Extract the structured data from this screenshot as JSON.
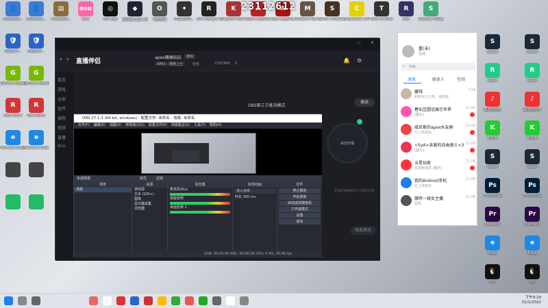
{
  "overlay": {
    "text": "23112612"
  },
  "desktop_left": [
    {
      "label": "Administr...",
      "color": "#3a7bd5",
      "glyph": "👤"
    },
    {
      "label": "DigiSoft...",
      "color": "#2a64c7",
      "glyph": "🛡"
    },
    {
      "label": "GeForce Experience",
      "color": "#76b900",
      "glyph": "G"
    },
    {
      "label": "Riot Client",
      "color": "#d13639",
      "glyph": "R"
    },
    {
      "label": "Microsoft Edge",
      "color": "#1e88e5",
      "glyph": "e"
    },
    {
      "label": "",
      "color": "#444",
      "glyph": ""
    },
    {
      "label": "",
      "color": "#2b6",
      "glyph": ""
    }
  ],
  "desktop_top": [
    {
      "label": "ItTakesTw...",
      "color": "#8a6c3c",
      "glyph": "▤"
    },
    {
      "label": "osu!",
      "color": "#ff66aa",
      "glyph": "osu"
    },
    {
      "label": "Aim Lab",
      "color": "#111",
      "glyph": "◎"
    },
    {
      "label": "战网ApexD2 2042",
      "color": "#223",
      "glyph": "◆"
    },
    {
      "label": "守望先锋",
      "color": "#555",
      "glyph": "O"
    },
    {
      "label": "HELLDIVE...",
      "color": "#333",
      "glyph": "✦"
    },
    {
      "label": "Tom Clancy's Rainbow...",
      "color": "#222",
      "glyph": "R"
    },
    {
      "label": "Kingdom Rush Vengeance",
      "color": "#a33",
      "glyph": "K"
    },
    {
      "label": "Apex Legends",
      "color": "#b22",
      "glyph": "A"
    },
    {
      "label": "Apex Legends",
      "color": "#a11",
      "glyph": "A"
    },
    {
      "label": "Medieval Dynasty",
      "color": "#654",
      "glyph": "M"
    },
    {
      "label": "Sekiro Shadows",
      "color": "#432",
      "glyph": "S"
    },
    {
      "label": "Cyberpunk 2077",
      "color": "#e5d100",
      "glyph": "C"
    },
    {
      "label": "Tales of Arise",
      "color": "#333",
      "glyph": "T"
    },
    {
      "label": "Raft",
      "color": "#336",
      "glyph": "R"
    },
    {
      "label": "Stardew Valley",
      "color": "#4a7",
      "glyph": "S"
    }
  ],
  "desktop_right": [
    {
      "label": "Steam",
      "color": "#1b2838",
      "glyph": "S"
    },
    {
      "label": "Razer",
      "color": "#2c8",
      "glyph": "R"
    },
    {
      "label": "网易云音乐",
      "color": "#e33",
      "glyph": "♪"
    },
    {
      "label": "KOOK",
      "color": "#2c3",
      "glyph": "K"
    },
    {
      "label": "Steam",
      "color": "#1b2838",
      "glyph": "S"
    },
    {
      "label": "Photoshop",
      "color": "#001e36",
      "glyph": "Ps"
    },
    {
      "label": "Premiere",
      "color": "#2a0845",
      "glyph": "Pr"
    },
    {
      "label": "Edge",
      "color": "#1e88e5",
      "glyph": "e"
    },
    {
      "label": "QQ",
      "color": "#111",
      "glyph": "🐧"
    }
  ],
  "stream_app": {
    "logo": "直播伴侣",
    "room_title": "apex随便玩玩",
    "room_tag": "游戏",
    "category": "APEX - 网络上分",
    "fans_label": "粉丝",
    "views": "7191969",
    "likes": "0",
    "mode_label": "OBS第三方推流模式",
    "exit_label": "退出",
    "start_label": "启动开播",
    "hint_label": "开播后请保持第三方推流正常",
    "end_label": "结束推流",
    "side_items": [
      "首页",
      "游戏",
      "全部",
      "宣传",
      "录制",
      "视频",
      "直播",
      "Kiro"
    ]
  },
  "obs": {
    "title": "OBS 27.1.3 (64-bit, windows) - 配置文件: 未命名 - 场景: 未命名",
    "menu": [
      "文件(F)",
      "编辑(E)",
      "视图(V)",
      "停靠窗口(D)",
      "配置文件(P)",
      "场景集合(S)",
      "工具(T)",
      "帮助(H)"
    ],
    "scene_label": "未选择源",
    "props_label": "属性",
    "filter_label": "滤镜",
    "docks": {
      "scenes": {
        "title": "场景",
        "items": [
          "场景"
        ]
      },
      "sources": {
        "title": "来源",
        "items": [
          "游戏源",
          "文本 (GDI+)",
          "图像",
          "显示器采集",
          "浏览器"
        ]
      },
      "mixer": {
        "title": "混音器",
        "items": [
          "麦克风/Aux",
          "桌面音频",
          "",
          "桌面音频 2"
        ],
        "levels": [
          "0.0 dB",
          "0.0 dB",
          "0.0 dB"
        ]
      },
      "transitions": {
        "title": "转场动画",
        "items": [
          "淡入淡出",
          "时长 300 ms"
        ]
      },
      "controls": {
        "title": "控件",
        "buttons": [
          "停止推流",
          "开始录制",
          "启动虚拟摄像机",
          "工作室模式",
          "设置",
          "退出"
        ]
      }
    },
    "status": "LIVE: 00:00:00   REC: 00:00:00   CPU: 0.4%, 30.00 fps"
  },
  "chat": {
    "user_name": "重(未)",
    "user_status": "在线",
    "search_placeholder": "搜索",
    "tabs": [
      "消息",
      "联系人",
      "空间"
    ],
    "items": [
      {
        "name": "藏钱",
        "preview": "新影片已上传，请查看",
        "time": "7:29",
        "color": "#c8b7a6",
        "badge": false
      },
      {
        "name": "春仙互圆话展示世界",
        "preview": "[图片]",
        "time": "21:06",
        "color": "#f5a",
        "badge": true
      },
      {
        "name": "威尼斯的apex水友群",
        "preview": "已上传成功",
        "time": "21:09",
        "color": "#e44",
        "badge": true
      },
      {
        "name": "<SyA>亲爱的自由骑士<3",
        "preview": "[图片]",
        "time": "21:09",
        "color": "#e35",
        "badge": true
      },
      {
        "name": "五星玩家",
        "preview": "欢迎新成员 [图片]",
        "time": "21:08",
        "color": "#f33",
        "badge": true
      },
      {
        "name": "我的Android手机",
        "preview": "已上传成功",
        "time": "21:08",
        "color": "#1d7ef0",
        "badge": false
      },
      {
        "name": "搬砖一级女主播",
        "preview": "在吗",
        "time": "21:08",
        "color": "#555",
        "badge": false
      }
    ]
  },
  "taskbar": {
    "time": "下午9:29",
    "date": "31/1/2022"
  }
}
